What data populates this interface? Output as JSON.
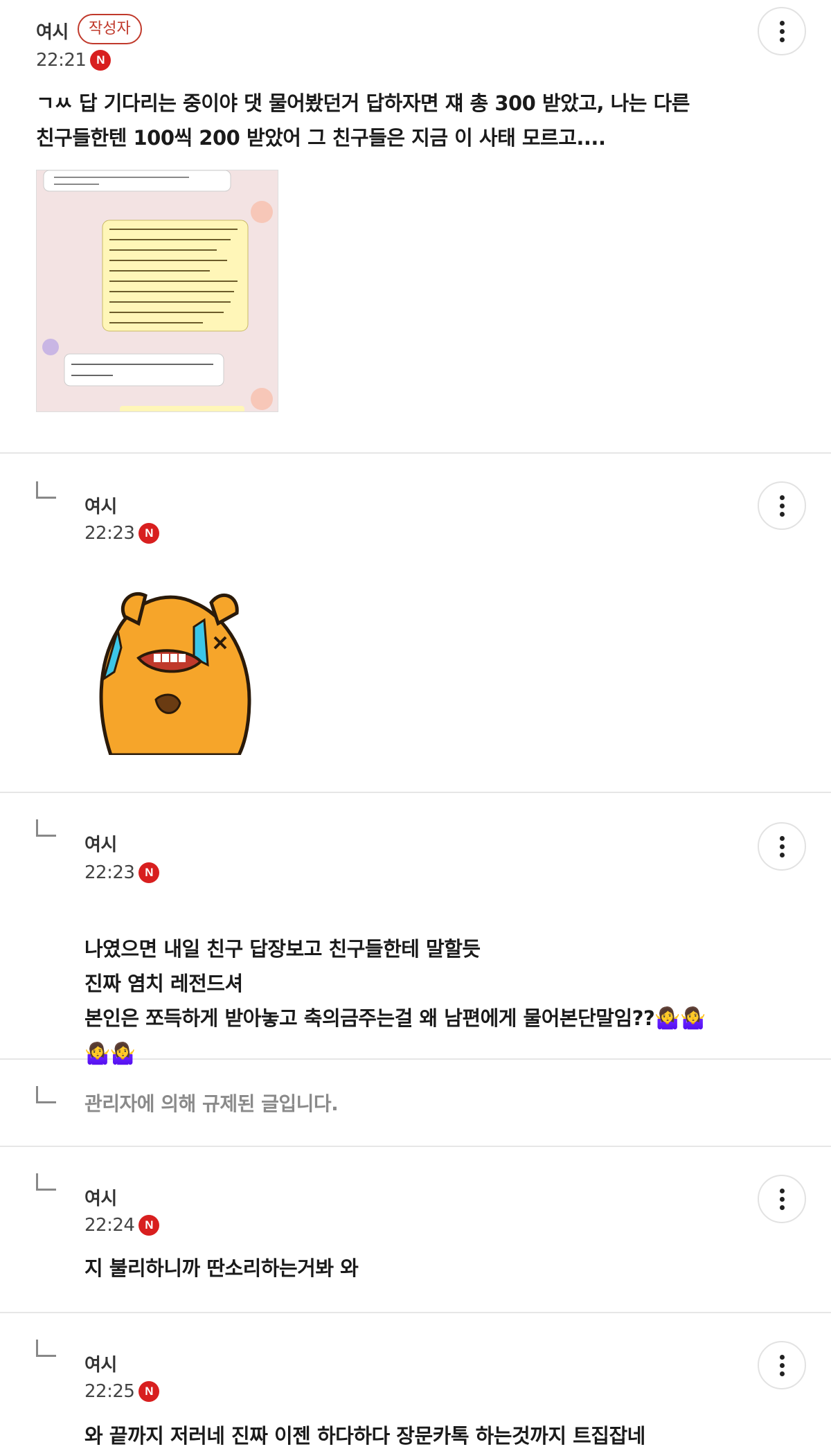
{
  "comments": [
    {
      "nickname": "여시",
      "author_badge": "작성자",
      "time": "22:21",
      "new_badge": "N",
      "text": "ㄱㅆ 답 기다리는 중이야 댓 물어봤던거 답하자면 쟤 총 300 받았고, 나는 다른\n친구들한텐 100씩 200 받았어 그 친구들은 지금 이 사태 모르고....",
      "has_photo": true
    },
    {
      "nickname": "여시",
      "time": "22:23",
      "new_badge": "N",
      "has_sticker": true
    },
    {
      "nickname": "여시",
      "time": "22:23",
      "new_badge": "N",
      "text": "나였으면 내일 친구 답장보고 친구들한테 말할듯\n진짜 염치 레전드셔\n본인은 쪼득하게 받아놓고 축의금주는걸 왜 남편에게 물어본단말임??",
      "emoji_tail": "🤷‍♀️🤷‍♀️",
      "emoji_line": "🤷‍♀️🤷‍♀️"
    },
    {
      "blocked_text": "관리자에 의해 규제된 글입니다."
    },
    {
      "nickname": "여시",
      "time": "22:24",
      "new_badge": "N",
      "text": "지 불리하니까 딴소리하는거봐 와"
    },
    {
      "nickname": "여시",
      "time": "22:25",
      "new_badge": "N",
      "text": "와 끝까지 저러네 진짜 이젠 하다하다 장문카톡 하는것까지 트집잡네"
    }
  ],
  "colors": {
    "accent_red": "#d81f1f",
    "author_badge": "#c0392b",
    "blocked_text": "#8a8a8a",
    "divider": "#e6e6e6"
  },
  "icons": {
    "more": "vertical-ellipsis-icon",
    "reply": "reply-arrow-icon",
    "new": "new-badge-icon"
  }
}
